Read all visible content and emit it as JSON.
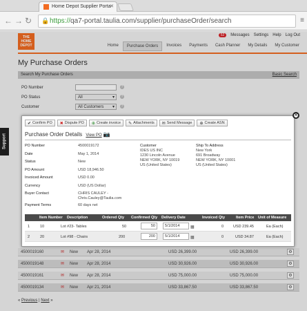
{
  "browser": {
    "tab_title": "Home Depot Supplier Porta",
    "url_https": "https://",
    "url_rest": "qa7-portal.taulia.com/supplier/purchaseOrder/search"
  },
  "header": {
    "logo_text": "THE HOME DEPOT",
    "messages_count": "52",
    "messages": "Messages",
    "settings": "Settings",
    "help": "Help",
    "logout": "Log Out",
    "nav": [
      "Home",
      "Purchase Orders",
      "Invoices",
      "Payments",
      "Cash Planner",
      "My Details",
      "My Customer"
    ]
  },
  "page": {
    "title": "My Purchase Orders",
    "search_title": "Search My Purchase Orders",
    "basic_search": "Basic Search",
    "po_number_label": "PO Number",
    "po_status_label": "PO Status",
    "po_status_value": "All",
    "customer_label": "Customer",
    "customer_value": "All Customers",
    "support": "Support"
  },
  "bg_rows": [
    {
      "po": "4500019160",
      "status": "New",
      "date": "Apr 28, 2014",
      "amount": "USD 26,399.00",
      "amount2": "USD 26,399.00"
    },
    {
      "po": "4500019148",
      "status": "New",
      "date": "Apr 28, 2014",
      "amount": "USD 30,926.00",
      "amount2": "USD 30,926.00"
    },
    {
      "po": "4500019161",
      "status": "New",
      "date": "Apr 28, 2014",
      "amount": "USD 75,000.00",
      "amount2": "USD 75,000.00"
    },
    {
      "po": "4500019134",
      "status": "New",
      "date": "Apr 21, 2014",
      "amount": "USD 33,867.50",
      "amount2": "USD 33,867.50"
    }
  ],
  "pager": {
    "prev": "Previous",
    "next": "Next"
  },
  "modal": {
    "buttons": [
      "Confirm PO",
      "Dispute PO",
      "Create invoice",
      "Attachments",
      "Send Message",
      "Create ASN"
    ],
    "title": "Purchase Order Details",
    "view_po": "View PO",
    "fields": [
      {
        "label": "PO Number",
        "value": "4500019172"
      },
      {
        "label": "Date",
        "value": "May 1, 2014"
      },
      {
        "label": "Status",
        "value": "New"
      },
      {
        "label": "PO Amount",
        "value": "USD 18,946.50"
      },
      {
        "label": "Invoiced Amount",
        "value": "USD 0.00"
      },
      {
        "label": "Currency",
        "value": "USD (US Dollar)"
      },
      {
        "label": "Buyer Contact",
        "value": "CHRIS CAULEY -"
      },
      {
        "label": "",
        "value": "Chris.Cauley@Taulia.com"
      },
      {
        "label": "Payment Terms",
        "value": "60 days net"
      }
    ],
    "customer": {
      "label": "Customer",
      "lines": [
        "IDES US INC",
        "1230 Lincoln Avenue",
        "NEW YORK, NY 10019",
        "US (United States)"
      ]
    },
    "ship_to": {
      "label": "Ship To Address",
      "lines": [
        "New York",
        "691 Broadway",
        "NEW YORK, NY 10001",
        "US (United States)"
      ]
    },
    "table": {
      "headers": [
        "Item Number",
        "Description",
        "Ordered Qty",
        "Confirmed Qty",
        "Delivery Date",
        "Invoiced Qty",
        "Item Price",
        "Unit of Measure"
      ],
      "rows": [
        {
          "idx": "1",
          "item": "10",
          "desc": "Lot #23- Tables",
          "ordered": "50",
          "confirmed": "50",
          "date": "5/1/2014",
          "invoiced": "0",
          "price": "USD 239.45",
          "uom": "Ea (Each)"
        },
        {
          "idx": "2",
          "item": "20",
          "desc": "Lot #98 - Chairs",
          "ordered": "200",
          "confirmed": "200",
          "date": "5/1/2014",
          "invoiced": "0",
          "price": "USD 34.87",
          "uom": "Ea (Each)"
        }
      ]
    }
  }
}
